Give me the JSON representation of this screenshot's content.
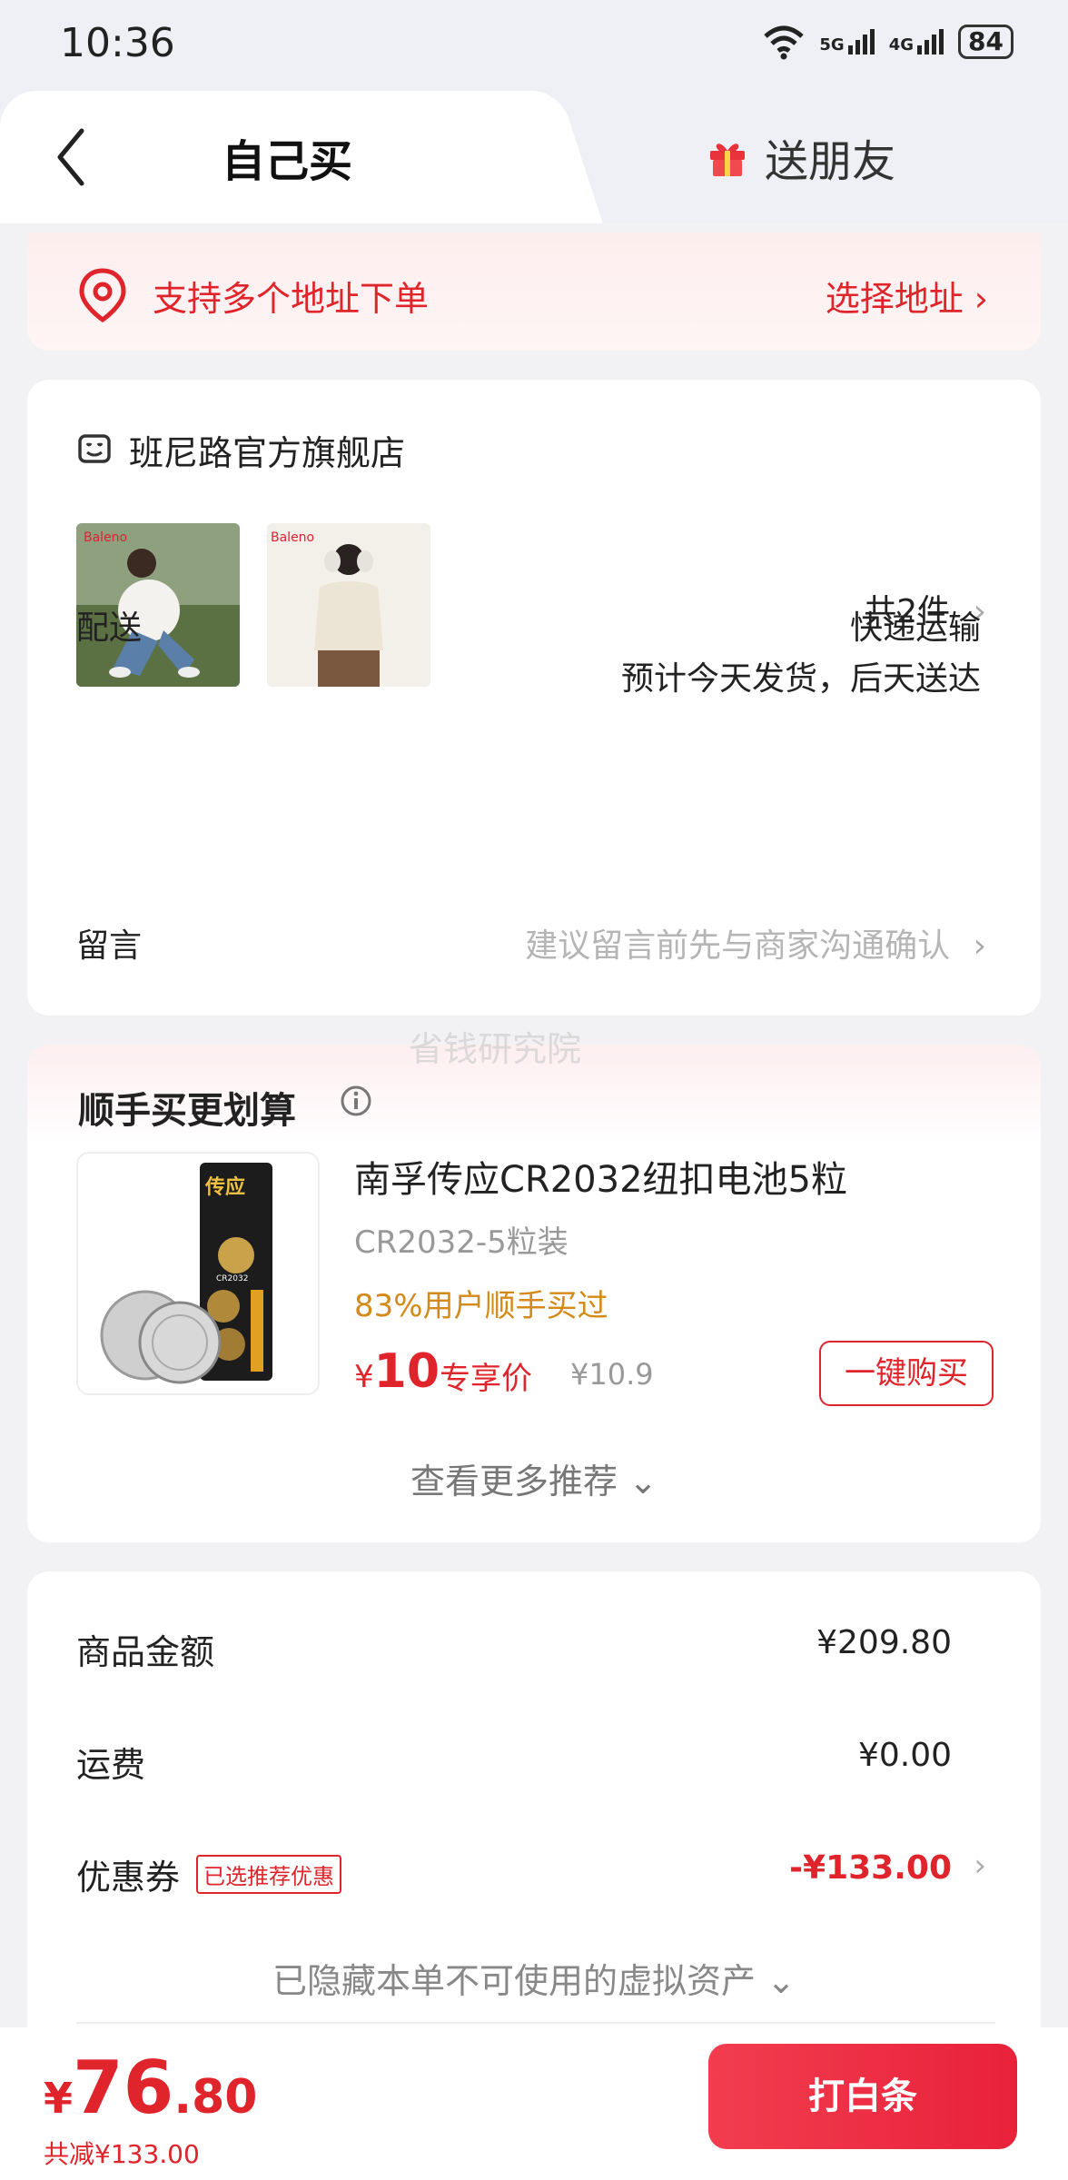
{
  "status_bar": {
    "time": "10:36",
    "net1": "5G",
    "net2": "4G",
    "battery": "84"
  },
  "header": {
    "tab_self": "自己买",
    "tab_gift": "送朋友"
  },
  "address": {
    "support_text": "支持多个地址下单",
    "select_label": "选择地址 ›"
  },
  "store": {
    "name": "班尼路官方旗舰店",
    "thumb_brand": "Baleno",
    "count_label": "共2件",
    "delivery_label": "配送",
    "delivery_method": "快递运输",
    "delivery_eta": "预计今天发货，后天送达",
    "message_label": "留言",
    "message_placeholder": "建议留言前先与商家沟通确认"
  },
  "watermark": "省钱研究院",
  "recommend": {
    "title": "顺手买更划算",
    "product_name": "南孚传应CR2032纽扣电池5粒",
    "product_spec": "CR2032-5粒装",
    "bought_rate": "83%用户顺手买过",
    "currency": "¥",
    "price": "10",
    "price_tag": "专享价",
    "original_price": "¥10.9",
    "buy_label": "一键购买",
    "more_label": "查看更多推荐 ⌄",
    "package_brand": "传应",
    "package_model": "CR2032"
  },
  "summary": {
    "goods_label": "商品金额",
    "goods_value": "¥209.80",
    "shipping_label": "运费",
    "shipping_value": "¥0.00",
    "coupon_label": "优惠券",
    "coupon_tag": "已选推荐优惠",
    "coupon_value": "-¥133.00",
    "hidden_label": "已隐藏本单不可使用的虚拟资产 ⌄"
  },
  "bottom": {
    "currency": "¥",
    "total_int": "76",
    "total_dec": ".80",
    "discount_text": "共减¥133.00",
    "pay_label": "打白条"
  },
  "colors": {
    "accent": "#e0242b",
    "orange": "#d48a18",
    "background": "#f2f2f4"
  }
}
